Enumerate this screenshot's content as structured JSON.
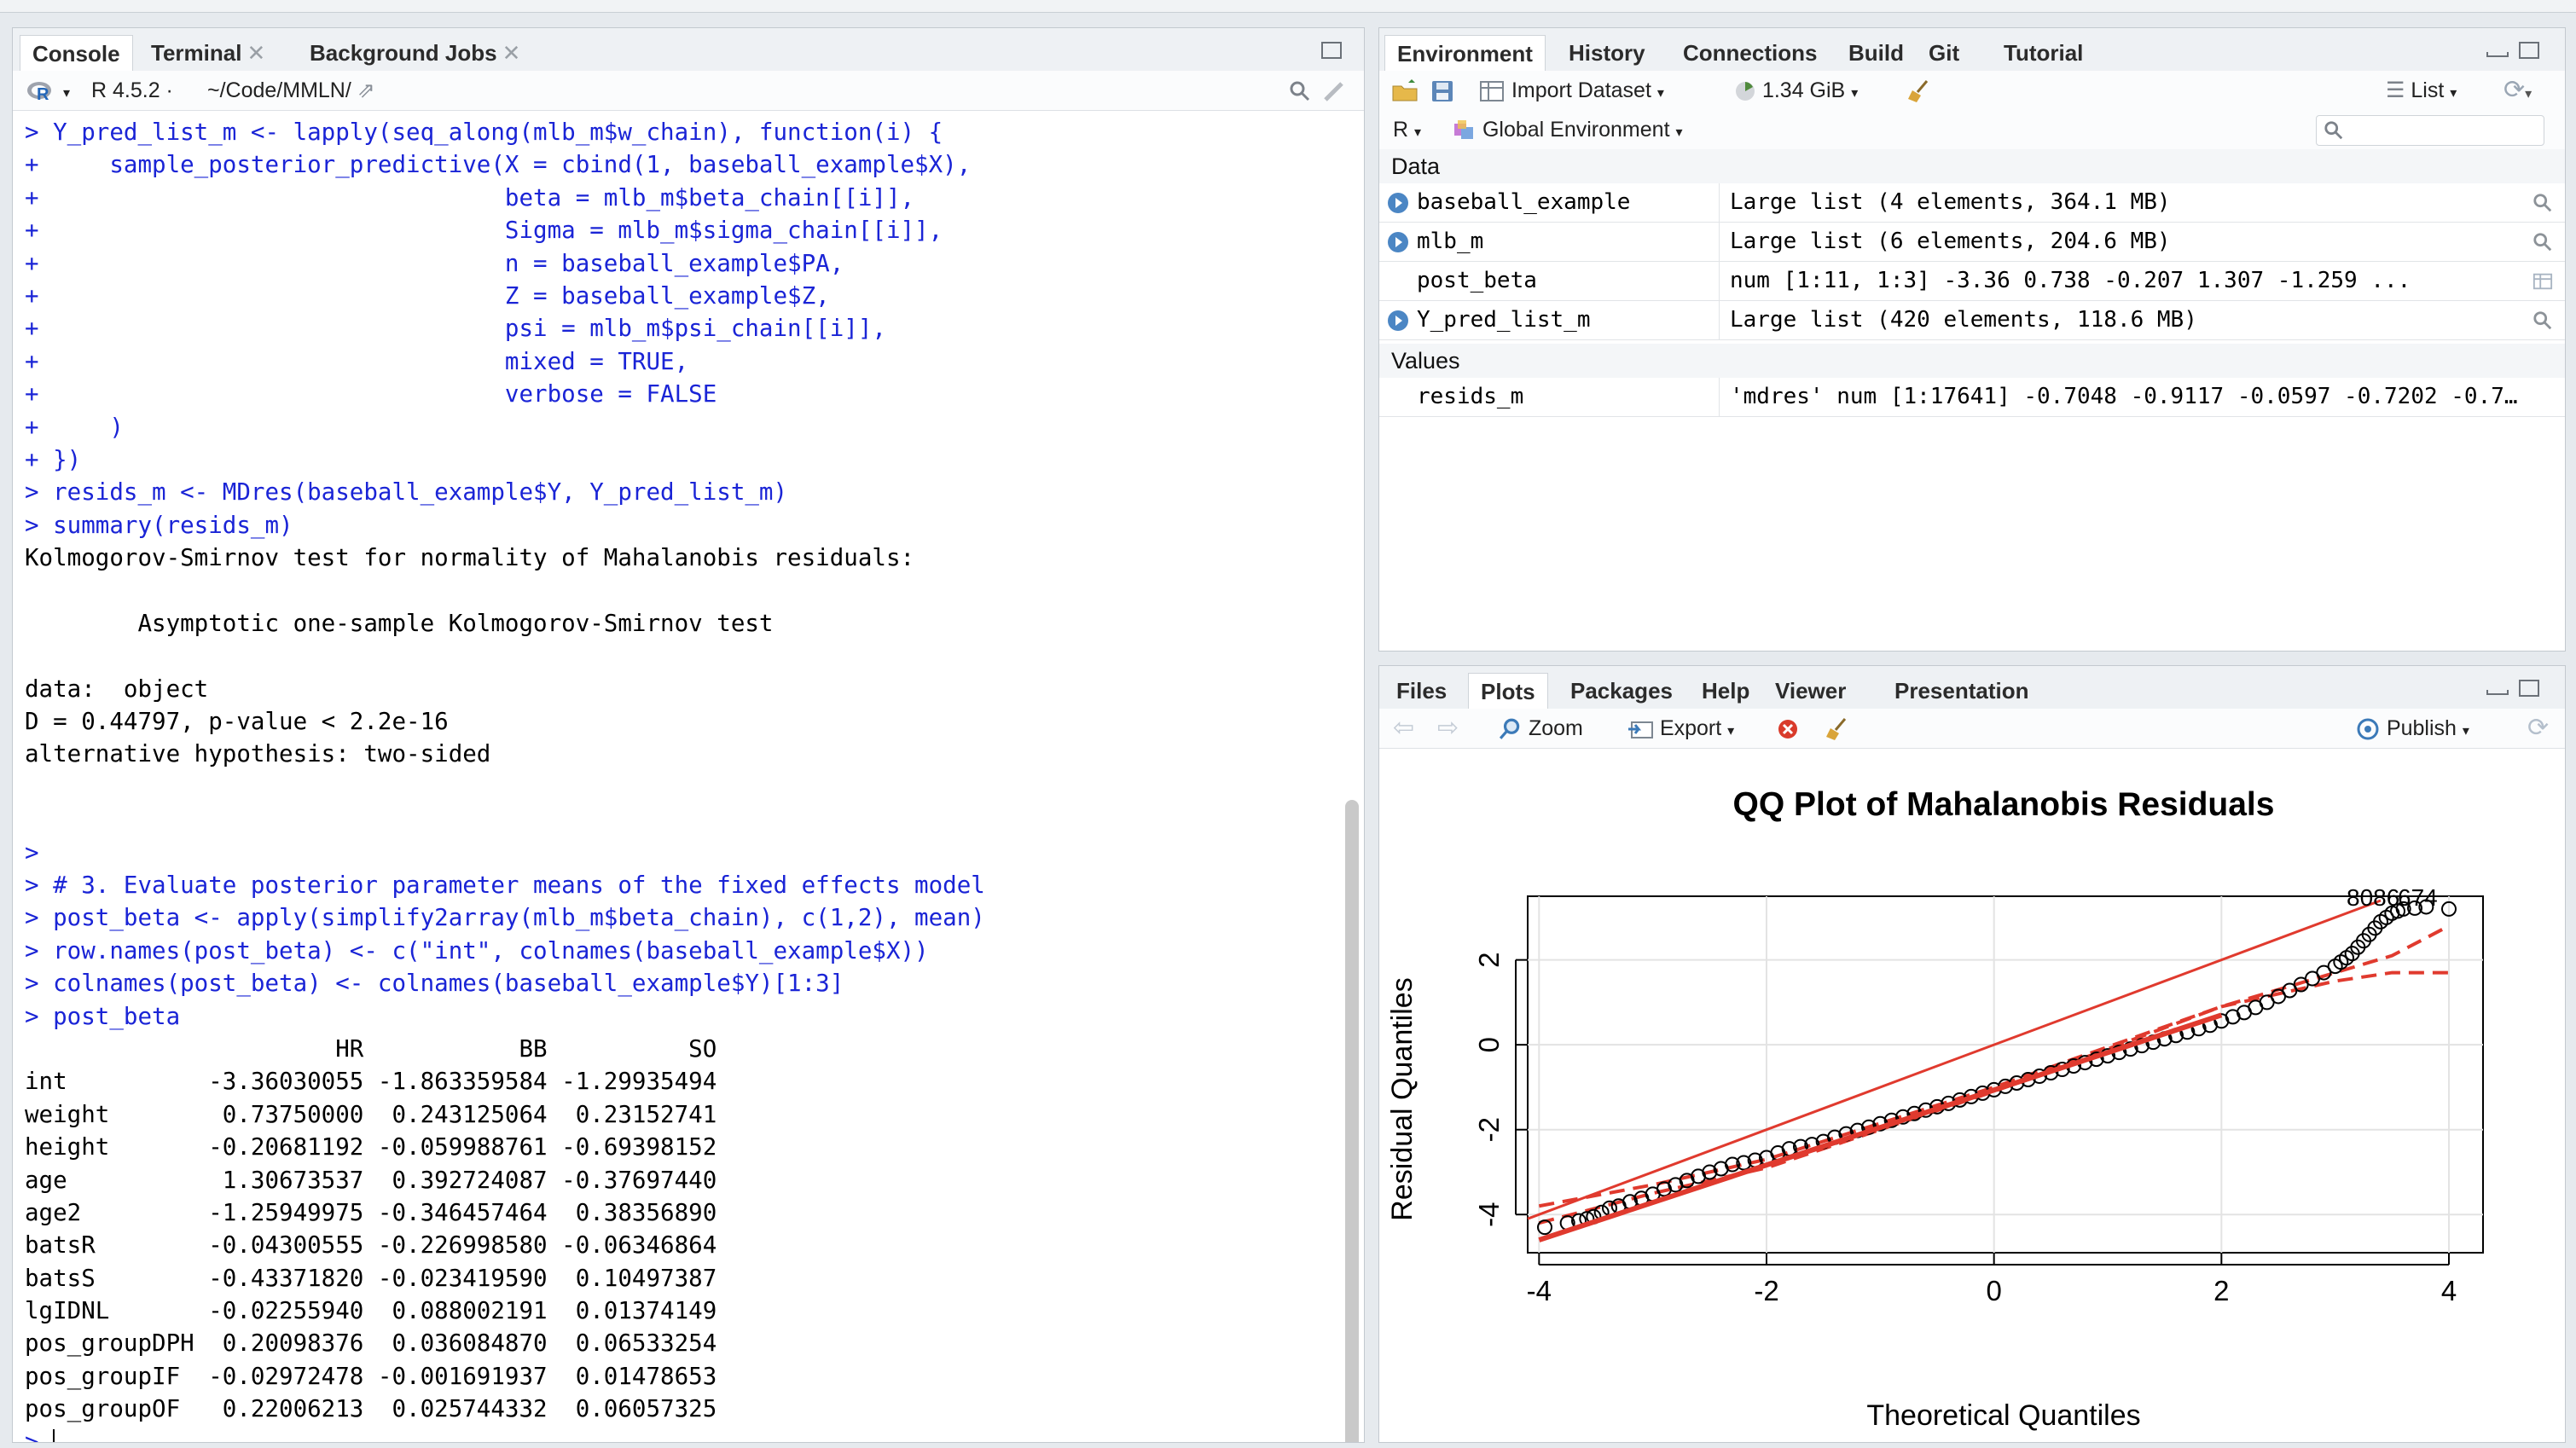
{
  "console_pane": {
    "tabs": [
      "Console",
      "Terminal",
      "Background Jobs"
    ],
    "r_version": "R 4.5.2",
    "path": "~/Code/MMLN/",
    "lines": [
      {
        "t": "> Y_pred_list_m <- lapply(seq_along(mlb_m$w_chain), function(i) {",
        "k": "in"
      },
      {
        "t": "+     sample_posterior_predictive(X = cbind(1, baseball_example$X),",
        "k": "in"
      },
      {
        "t": "+                                 beta = mlb_m$beta_chain[[i]],",
        "k": "in"
      },
      {
        "t": "+                                 Sigma = mlb_m$sigma_chain[[i]],",
        "k": "in"
      },
      {
        "t": "+                                 n = baseball_example$PA,",
        "k": "in"
      },
      {
        "t": "+                                 Z = baseball_example$Z,",
        "k": "in"
      },
      {
        "t": "+                                 psi = mlb_m$psi_chain[[i]],",
        "k": "in"
      },
      {
        "t": "+                                 mixed = TRUE,",
        "k": "in"
      },
      {
        "t": "+                                 verbose = FALSE",
        "k": "in"
      },
      {
        "t": "+     )",
        "k": "in"
      },
      {
        "t": "+ })",
        "k": "in"
      },
      {
        "t": "> resids_m <- MDres(baseball_example$Y, Y_pred_list_m)",
        "k": "in"
      },
      {
        "t": "> summary(resids_m)",
        "k": "in"
      },
      {
        "t": "Kolmogorov-Smirnov test for normality of Mahalanobis residuals:",
        "k": "out"
      },
      {
        "t": "",
        "k": "out"
      },
      {
        "t": "        Asymptotic one-sample Kolmogorov-Smirnov test",
        "k": "out"
      },
      {
        "t": "",
        "k": "out"
      },
      {
        "t": "data:  object",
        "k": "out"
      },
      {
        "t": "D = 0.44797, p-value < 2.2e-16",
        "k": "out"
      },
      {
        "t": "alternative hypothesis: two-sided",
        "k": "out"
      },
      {
        "t": "",
        "k": "out"
      },
      {
        "t": "",
        "k": "out"
      },
      {
        "t": ">",
        "k": "in"
      },
      {
        "t": "> # 3. Evaluate posterior parameter means of the fixed effects model",
        "k": "in"
      },
      {
        "t": "> post_beta <- apply(simplify2array(mlb_m$beta_chain), c(1,2), mean)",
        "k": "in"
      },
      {
        "t": "> row.names(post_beta) <- c(\"int\", colnames(baseball_example$X))",
        "k": "in"
      },
      {
        "t": "> colnames(post_beta) <- colnames(baseball_example$Y)[1:3]",
        "k": "in"
      },
      {
        "t": "> post_beta",
        "k": "in"
      },
      {
        "t": "                      HR           BB          SO",
        "k": "out"
      },
      {
        "t": "int          -3.36030055 -1.863359584 -1.29935494",
        "k": "out"
      },
      {
        "t": "weight        0.73750000  0.243125064  0.23152741",
        "k": "out"
      },
      {
        "t": "height       -0.20681192 -0.059988761 -0.69398152",
        "k": "out"
      },
      {
        "t": "age           1.30673537  0.392724087 -0.37697440",
        "k": "out"
      },
      {
        "t": "age2         -1.25949975 -0.346457464  0.38356890",
        "k": "out"
      },
      {
        "t": "batsR        -0.04300555 -0.226998580 -0.06346864",
        "k": "out"
      },
      {
        "t": "batsS        -0.43371820 -0.023419590  0.10497387",
        "k": "out"
      },
      {
        "t": "lgIDNL       -0.02255940  0.088002191  0.01374149",
        "k": "out"
      },
      {
        "t": "pos_groupDPH  0.20098376  0.036084870  0.06533254",
        "k": "out"
      },
      {
        "t": "pos_groupIF  -0.02972478 -0.001691937  0.01478653",
        "k": "out"
      },
      {
        "t": "pos_groupOF   0.22006213  0.025744332  0.06057325",
        "k": "out"
      },
      {
        "t": "> ",
        "k": "in"
      }
    ]
  },
  "env_pane": {
    "tabs": [
      "Environment",
      "History",
      "Connections",
      "Build",
      "Git",
      "Tutorial"
    ],
    "toolbar": {
      "import": "Import Dataset",
      "memory": "1.34 GiB",
      "view": "List"
    },
    "language": "R",
    "scope": "Global Environment",
    "search_placeholder": "",
    "data_header": "Data",
    "data_rows": [
      {
        "name": "baseball_example",
        "value": "Large list (4 elements, 364.1 MB)",
        "expand": true,
        "icon": "search"
      },
      {
        "name": "mlb_m",
        "value": "Large list (6 elements, 204.6 MB)",
        "expand": true,
        "icon": "search"
      },
      {
        "name": "post_beta",
        "value": "num [1:11, 1:3] -3.36 0.738 -0.207 1.307 -1.259 ...",
        "expand": false,
        "icon": "grid"
      },
      {
        "name": "Y_pred_list_m",
        "value": "Large list (420 elements, 118.6 MB)",
        "expand": true,
        "icon": "search"
      }
    ],
    "values_header": "Values",
    "value_rows": [
      {
        "name": "resids_m",
        "value": "'mdres' num [1:17641] -0.7048 -0.9117 -0.0597 -0.7202 -0.7…"
      }
    ]
  },
  "files_pane": {
    "tabs": [
      "Files",
      "Plots",
      "Packages",
      "Help",
      "Viewer",
      "Presentation"
    ],
    "toolbar": {
      "zoom": "Zoom",
      "export": "Export",
      "publish": "Publish"
    }
  },
  "chart_data": {
    "type": "scatter",
    "title": "QQ Plot of Mahalanobis Residuals",
    "xlabel": "Theoretical Quantiles",
    "ylabel": "Residual Quantiles",
    "xlim": [
      -4.1,
      4.3
    ],
    "ylim": [
      -4.9,
      3.5
    ],
    "xticks": [
      -4,
      -2,
      0,
      2,
      4
    ],
    "yticks": [
      -4,
      -2,
      0,
      2
    ],
    "outlier_labels": [
      "8086",
      "674"
    ],
    "reference_line": {
      "slope": 1,
      "intercept": 0,
      "color": "#e03a2e"
    },
    "fit_line": {
      "x": [
        -4,
        2
      ],
      "y": [
        -4.6,
        0.7
      ],
      "color": "#e03a2e"
    },
    "envelope": {
      "lower": {
        "x": [
          -4.0,
          -3.0,
          -2.0,
          0.0,
          2.0,
          3.0,
          3.5,
          4.0
        ],
        "y": [
          -4.2,
          -3.5,
          -2.9,
          -1.1,
          0.9,
          1.5,
          1.7,
          1.7
        ]
      },
      "upper": {
        "x": [
          -4.0,
          -3.0,
          -2.0,
          0.0,
          2.0,
          3.0,
          3.5,
          4.0
        ],
        "y": [
          -3.8,
          -3.3,
          -2.7,
          -1.0,
          0.9,
          1.7,
          2.1,
          2.8
        ]
      },
      "color": "#e03a2e"
    },
    "points": {
      "x": [
        -3.95,
        -3.75,
        -3.65,
        -3.58,
        -3.52,
        -3.45,
        -3.38,
        -3.3,
        -3.2,
        -3.1,
        -3.0,
        -2.9,
        -2.8,
        -2.7,
        -2.6,
        -2.5,
        -2.4,
        -2.3,
        -2.2,
        -2.1,
        -2.0,
        -1.9,
        -1.8,
        -1.7,
        -1.6,
        -1.5,
        -1.4,
        -1.3,
        -1.2,
        -1.1,
        -1.0,
        -0.9,
        -0.8,
        -0.7,
        -0.6,
        -0.5,
        -0.4,
        -0.3,
        -0.2,
        -0.1,
        0.0,
        0.1,
        0.2,
        0.3,
        0.4,
        0.5,
        0.6,
        0.7,
        0.8,
        0.9,
        1.0,
        1.1,
        1.2,
        1.3,
        1.4,
        1.5,
        1.6,
        1.7,
        1.8,
        1.9,
        2.0,
        2.1,
        2.2,
        2.3,
        2.4,
        2.5,
        2.6,
        2.7,
        2.8,
        2.9,
        3.0,
        3.05,
        3.1,
        3.15,
        3.2,
        3.25,
        3.3,
        3.35,
        3.4,
        3.45,
        3.5,
        3.55,
        3.6,
        3.7,
        3.8,
        4.0
      ],
      "y": [
        -4.3,
        -4.2,
        -4.15,
        -4.1,
        -4.05,
        -3.95,
        -3.85,
        -3.8,
        -3.7,
        -3.62,
        -3.52,
        -3.4,
        -3.3,
        -3.2,
        -3.1,
        -3.0,
        -2.92,
        -2.82,
        -2.78,
        -2.72,
        -2.66,
        -2.55,
        -2.45,
        -2.4,
        -2.35,
        -2.28,
        -2.18,
        -2.1,
        -2.02,
        -1.94,
        -1.86,
        -1.78,
        -1.7,
        -1.62,
        -1.54,
        -1.46,
        -1.38,
        -1.3,
        -1.22,
        -1.14,
        -1.06,
        -0.98,
        -0.9,
        -0.82,
        -0.74,
        -0.66,
        -0.58,
        -0.5,
        -0.42,
        -0.34,
        -0.26,
        -0.18,
        -0.1,
        -0.02,
        0.06,
        0.14,
        0.22,
        0.3,
        0.38,
        0.46,
        0.56,
        0.66,
        0.76,
        0.88,
        1.0,
        1.14,
        1.28,
        1.42,
        1.56,
        1.7,
        1.85,
        1.95,
        2.05,
        2.15,
        2.3,
        2.45,
        2.6,
        2.75,
        2.9,
        3.0,
        3.1,
        3.15,
        3.2,
        3.22,
        3.25,
        3.2
      ]
    }
  }
}
